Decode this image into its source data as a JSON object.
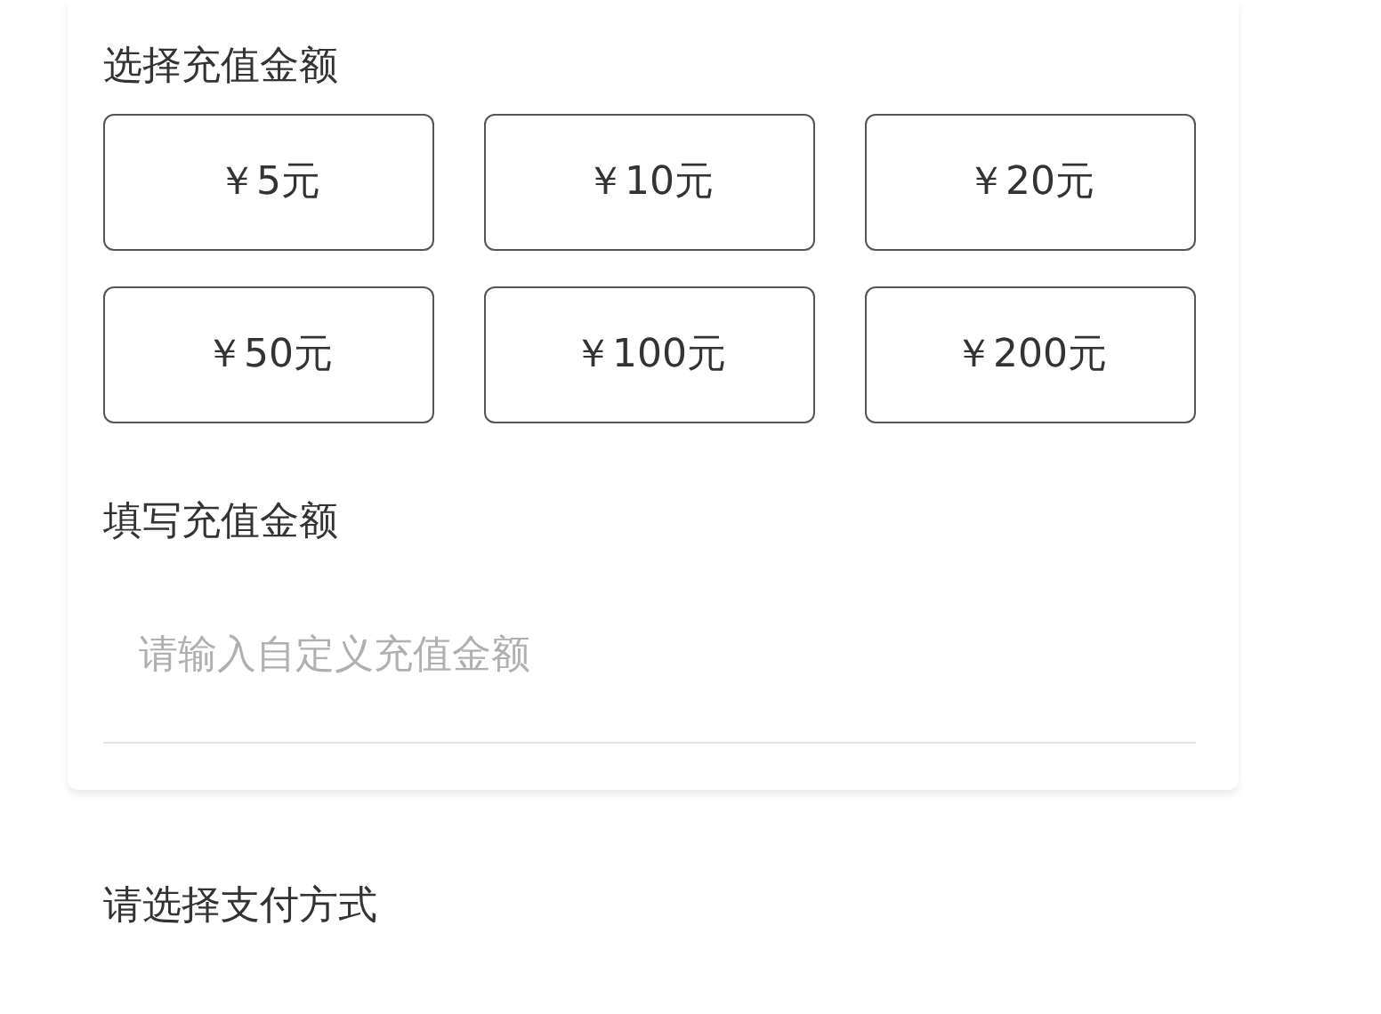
{
  "amount_section": {
    "title": "选择充值金额",
    "options": [
      {
        "label": "￥5元"
      },
      {
        "label": "￥10元"
      },
      {
        "label": "￥20元"
      },
      {
        "label": "￥50元"
      },
      {
        "label": "￥100元"
      },
      {
        "label": "￥200元"
      }
    ]
  },
  "custom_section": {
    "title": "填写充值金额",
    "placeholder": "请输入自定义充值金额"
  },
  "payment_section": {
    "title": "请选择支付方式"
  }
}
